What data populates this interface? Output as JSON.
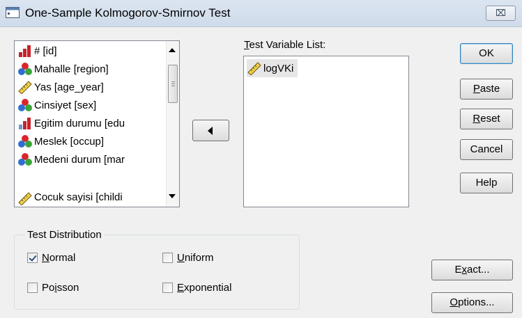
{
  "window": {
    "title": "One-Sample Kolmogorov-Smirnov Test",
    "close_glyph": "⌧"
  },
  "source_list": {
    "items": [
      {
        "label": "# [id]",
        "icon": "scale-nominal-bar-icon"
      },
      {
        "label": "Mahalle [region]",
        "icon": "nominal-balls-icon"
      },
      {
        "label": "Yas [age_year]",
        "icon": "scale-ruler-icon"
      },
      {
        "label": "Cinsiyet [sex]",
        "icon": "nominal-balls-icon"
      },
      {
        "label": "Egitim durumu [edu",
        "icon": "ordinal-bar-icon"
      },
      {
        "label": "Meslek [occup]",
        "icon": "nominal-balls-icon"
      },
      {
        "label": "Medeni durum [mar",
        "icon": "nominal-balls-icon"
      },
      {
        "label": "Cocuk sayisi [childi",
        "icon": "scale-ruler-icon"
      }
    ]
  },
  "target": {
    "label_first": "T",
    "label_rest": "est Variable List:",
    "items": [
      {
        "label": "logVKi",
        "icon": "scale-ruler-icon"
      }
    ]
  },
  "buttons": {
    "ok": "OK",
    "paste_u": "P",
    "paste_rest": "aste",
    "reset_u": "R",
    "reset_rest": "eset",
    "cancel": "Cancel",
    "help": "Help",
    "exact_pre": "E",
    "exact_u": "x",
    "exact_rest": "act...",
    "options_u": "O",
    "options_rest": "ptions..."
  },
  "test_distribution": {
    "legend": "Test Distribution",
    "normal": {
      "u": "N",
      "rest": "ormal",
      "checked": true
    },
    "uniform": {
      "u": "U",
      "rest": "niform",
      "checked": false
    },
    "poisson": {
      "pre": "Po",
      "u": "i",
      "rest": "sson",
      "checked": false
    },
    "exponential": {
      "u": "E",
      "rest": "xponential",
      "checked": false
    }
  },
  "colors": {
    "titlebar": "#dbe5f1",
    "dialog_bg": "#f0f0f0",
    "default_button_border": "#3c7fb1"
  }
}
